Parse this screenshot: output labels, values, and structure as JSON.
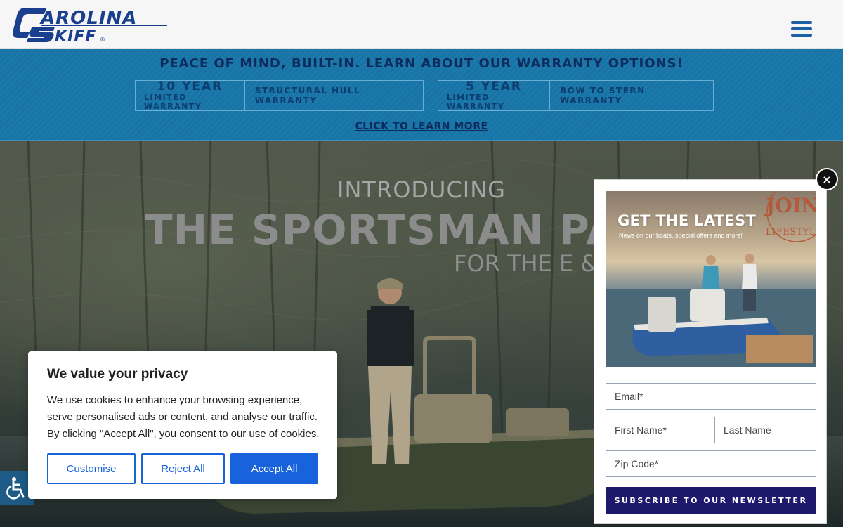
{
  "header": {
    "logo_text": "CAROLINA SKIFF",
    "menu_icon": "hamburger-menu-icon"
  },
  "warranty": {
    "heading": "PEACE OF MIND, BUILT-IN. LEARN ABOUT OUR WARRANTY OPTIONS!",
    "options": [
      {
        "years": "10 YEAR",
        "limited": "LIMITED WARRANTY",
        "type": "STRUCTURAL HULL WARRANTY"
      },
      {
        "years": "5 YEAR",
        "limited": "LIMITED WARRANTY",
        "type": "BOW TO STERN WARRANTY"
      }
    ],
    "cta": "CLICK TO LEARN MORE"
  },
  "hero": {
    "intro": "INTRODUCING",
    "title": "THE SPORTSMAN PACK",
    "subtitle": "FOR THE E &"
  },
  "accessibility": {
    "icon": "wheelchair-accessibility-icon"
  },
  "cookie": {
    "title": "We value your privacy",
    "text": "We use cookies to enhance your browsing experience, serve personalised ads or content, and analyse our traffic. By clicking \"Accept All\", you consent to our use of cookies.",
    "customise": "Customise",
    "reject": "Reject All",
    "accept": "Accept All",
    "accent_color": "#1863dc"
  },
  "newsletter": {
    "close_label": "×",
    "promo_headline": "GET THE LATEST",
    "promo_sub": "News on our boats, special offers and more!",
    "promo_join": "JOIN",
    "promo_lifestyle": "LIFESTYLE",
    "email_placeholder": "Email*",
    "first_name_placeholder": "First Name*",
    "last_name_placeholder": "Last Name",
    "zip_placeholder": "Zip Code*",
    "subscribe_label": "SUBSCRIBE TO OUR NEWSLETTER",
    "button_color": "#1d1a6e"
  }
}
